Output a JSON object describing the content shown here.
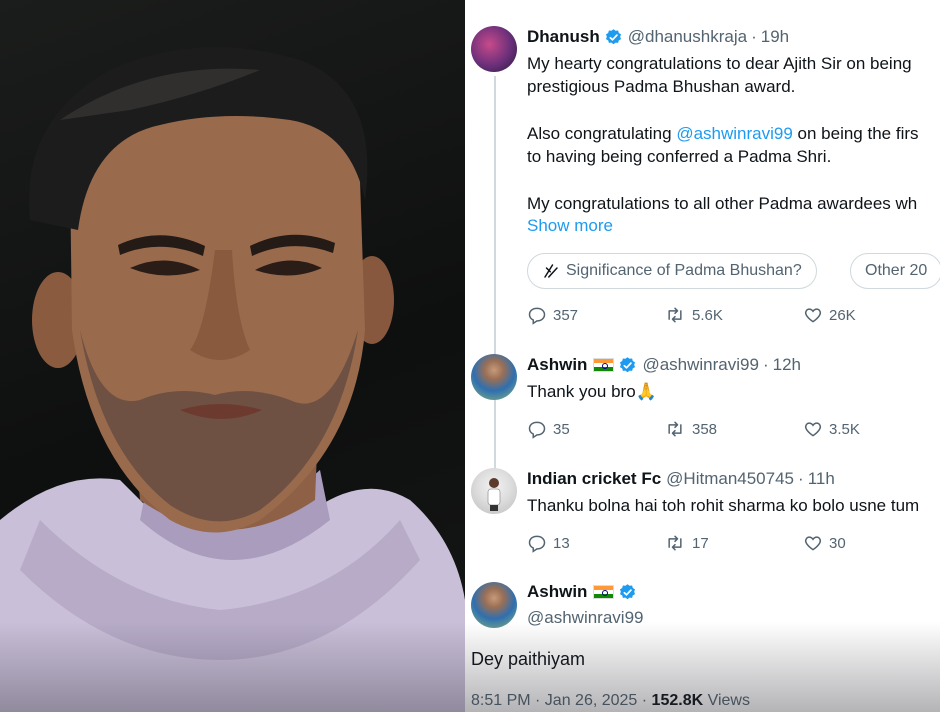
{
  "photo": {
    "description_icon": "portrait-photo"
  },
  "thread": {
    "tweet": {
      "author_name": "Dhanush",
      "handle": "@dhanushkraja",
      "separator": "·",
      "time": "19h",
      "lines": [
        "My hearty congratulations to dear Ajith Sir on being",
        "prestigious Padma Bhushan award."
      ],
      "line3_prefix": "Also congratulating ",
      "line3_mention": "@ashwinravi99",
      "line3_suffix": " on being the firs",
      "line4": "to having being conferred a Padma Shri.",
      "line5": "My congratulations to all other Padma awardees wh",
      "show_more": "Show more",
      "pills": [
        "Significance of Padma Bhushan?",
        "Other 20"
      ],
      "replies": "357",
      "reposts": "5.6K",
      "likes": "26K"
    },
    "reply1": {
      "author_name": "Ashwin",
      "handle": "@ashwinravi99",
      "separator": "·",
      "time": "12h",
      "text": "Thank you bro🙏",
      "replies": "35",
      "reposts": "358",
      "likes": "3.5K"
    },
    "reply2": {
      "author_name": "Indian cricket Fc",
      "handle": "@Hitman450745",
      "separator": "·",
      "time": "11h",
      "text": "Thanku bolna hai toh rohit sharma ko bolo usne tum",
      "replies": "13",
      "reposts": "17",
      "likes": "30"
    },
    "reply3": {
      "author_name": "Ashwin",
      "handle": "@ashwinravi99",
      "text": "Dey paithiyam",
      "timestamp": "8:51 PM · Jan 26, 2025 · ",
      "views_count": "152.8K",
      "views_label": " Views"
    }
  },
  "colors": {
    "accent": "#1d9bf0",
    "muted": "#536471",
    "border": "#cfd9de"
  }
}
